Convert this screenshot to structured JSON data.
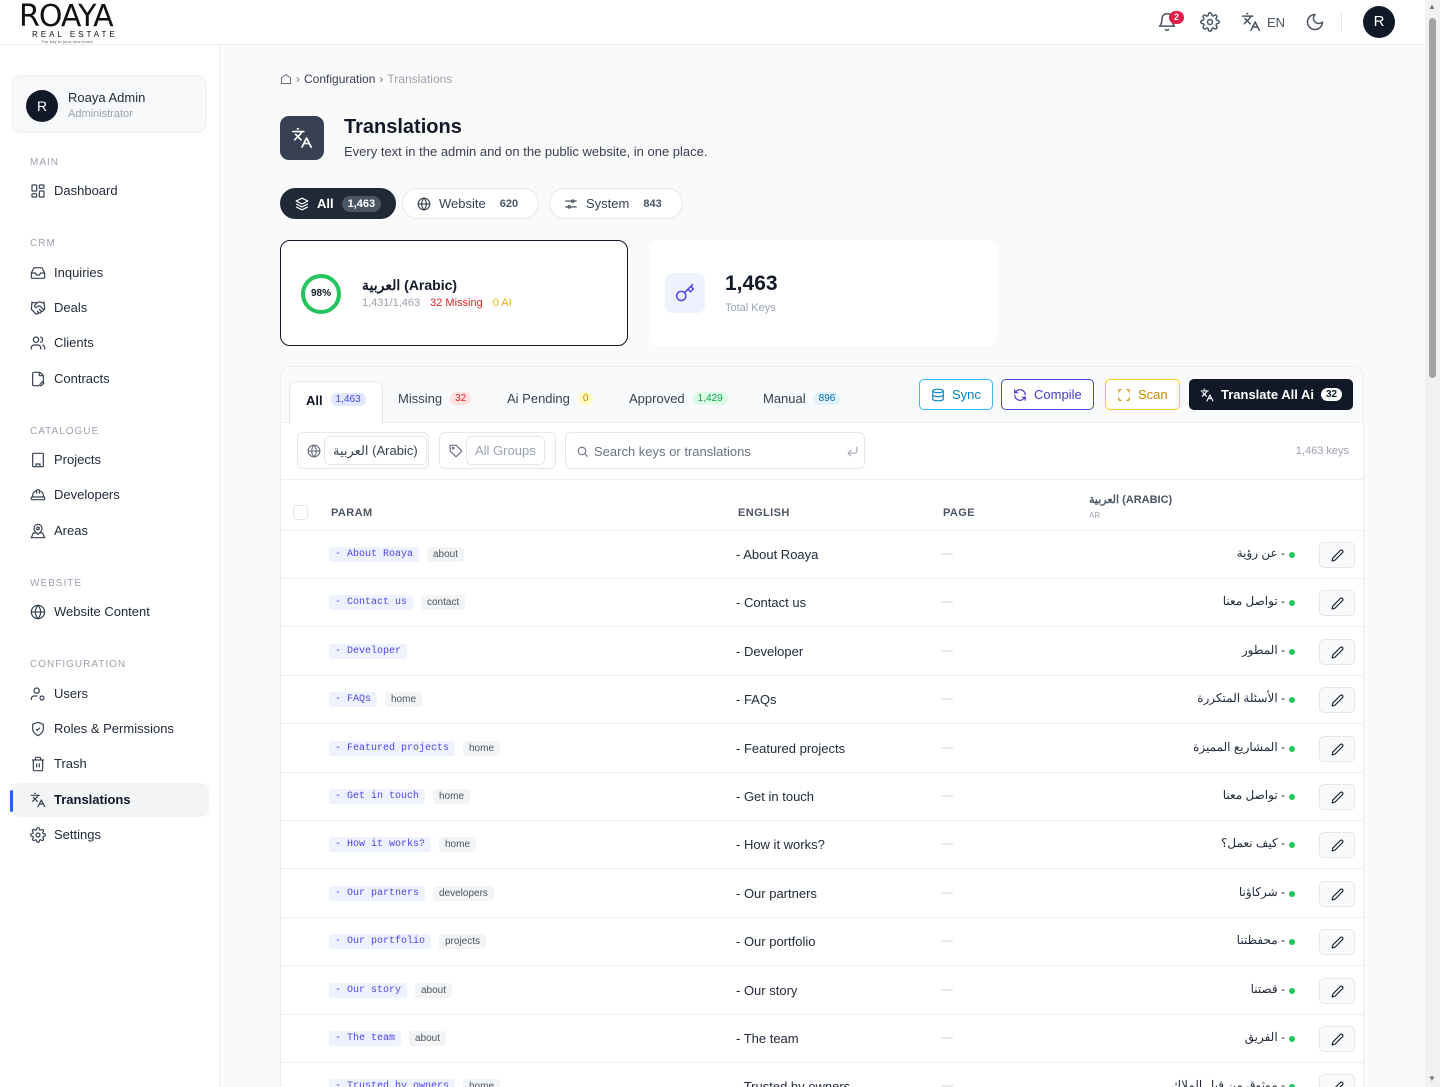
{
  "brand": {
    "name": "ROAYA",
    "sub": "REAL ESTATE",
    "tagline": "The key to your new home"
  },
  "topbar": {
    "notif_count": "2",
    "lang": "EN",
    "avatar": "R"
  },
  "user": {
    "avatar": "R",
    "name": "Roaya Admin",
    "role": "Administrator"
  },
  "nav": {
    "main_title": "MAIN",
    "dashboard": "Dashboard",
    "crm_title": "CRM",
    "inquiries": "Inquiries",
    "deals": "Deals",
    "clients": "Clients",
    "contracts": "Contracts",
    "catalogue_title": "CATALOGUE",
    "projects": "Projects",
    "developers": "Developers",
    "areas": "Areas",
    "website_title": "WEBSITE",
    "website_content": "Website Content",
    "config_title": "CONFIGURATION",
    "users": "Users",
    "roles": "Roles & Permissions",
    "trash": "Trash",
    "translations": "Translations",
    "settings": "Settings"
  },
  "breadcrumb": {
    "parent": "Configuration",
    "current": "Translations"
  },
  "page": {
    "title": "Translations",
    "subtitle": "Every text in the admin and on the public website, in one place."
  },
  "scopes": [
    {
      "label": "All",
      "count": "1,463"
    },
    {
      "label": "Website",
      "count": "620"
    },
    {
      "label": "System",
      "count": "843"
    }
  ],
  "lang_card": {
    "percent": 0.98,
    "percent_label": "98%",
    "name": "العربية (Arabic)",
    "ratio": "1,431/1,463",
    "missing": "32 Missing",
    "ai": "0 AI"
  },
  "total_card": {
    "value": "1,463",
    "label": "Total Keys"
  },
  "tabs": [
    {
      "label": "All",
      "count": "1,463"
    },
    {
      "label": "Missing",
      "count": "32"
    },
    {
      "label": "Ai Pending",
      "count": "0"
    },
    {
      "label": "Approved",
      "count": "1,429"
    },
    {
      "label": "Manual",
      "count": "896"
    }
  ],
  "actions": {
    "sync": "Sync",
    "compile": "Compile",
    "scan": "Scan",
    "translate_all": "Translate All Ai",
    "translate_count": "32"
  },
  "filters": {
    "language": "العربية (Arabic)",
    "group": "All Groups",
    "search_placeholder": "Search keys or translations",
    "keys_count": "1,463 keys"
  },
  "table": {
    "headers": {
      "param": "PARAM",
      "english": "ENGLISH",
      "page": "PAGE",
      "arabic": "العربية (ARABIC)",
      "arabic_code": "AR"
    },
    "empty_page": "—",
    "rows": [
      {
        "param": "- About Roaya",
        "group": "about",
        "en": "- About Roaya",
        "ar": "- عن رؤية"
      },
      {
        "param": "- Contact us",
        "group": "contact",
        "en": "- Contact us",
        "ar": "- تواصل معنا"
      },
      {
        "param": "- Developer",
        "group": "",
        "en": "- Developer",
        "ar": "- المطور"
      },
      {
        "param": "- FAQs",
        "group": "home",
        "en": "- FAQs",
        "ar": "- الأسئلة المتكررة"
      },
      {
        "param": "- Featured projects",
        "group": "home",
        "en": "- Featured projects",
        "ar": "- المشاريع المميزة"
      },
      {
        "param": "- Get in touch",
        "group": "home",
        "en": "- Get in touch",
        "ar": "- تواصل معنا"
      },
      {
        "param": "- How it works?",
        "group": "home",
        "en": "- How it works?",
        "ar": "- كيف نعمل؟"
      },
      {
        "param": "- Our partners",
        "group": "developers",
        "en": "- Our partners",
        "ar": "- شركاؤنا"
      },
      {
        "param": "- Our portfolio",
        "group": "projects",
        "en": "- Our portfolio",
        "ar": "- محفظتنا"
      },
      {
        "param": "- Our story",
        "group": "about",
        "en": "- Our story",
        "ar": "- قصتنا"
      },
      {
        "param": "- The team",
        "group": "about",
        "en": "- The team",
        "ar": "- الفريق"
      },
      {
        "param": "- Trusted by owners",
        "group": "home",
        "en": "- Trusted by owners",
        "ar": "- موثوق من قبل الملاك"
      }
    ]
  }
}
